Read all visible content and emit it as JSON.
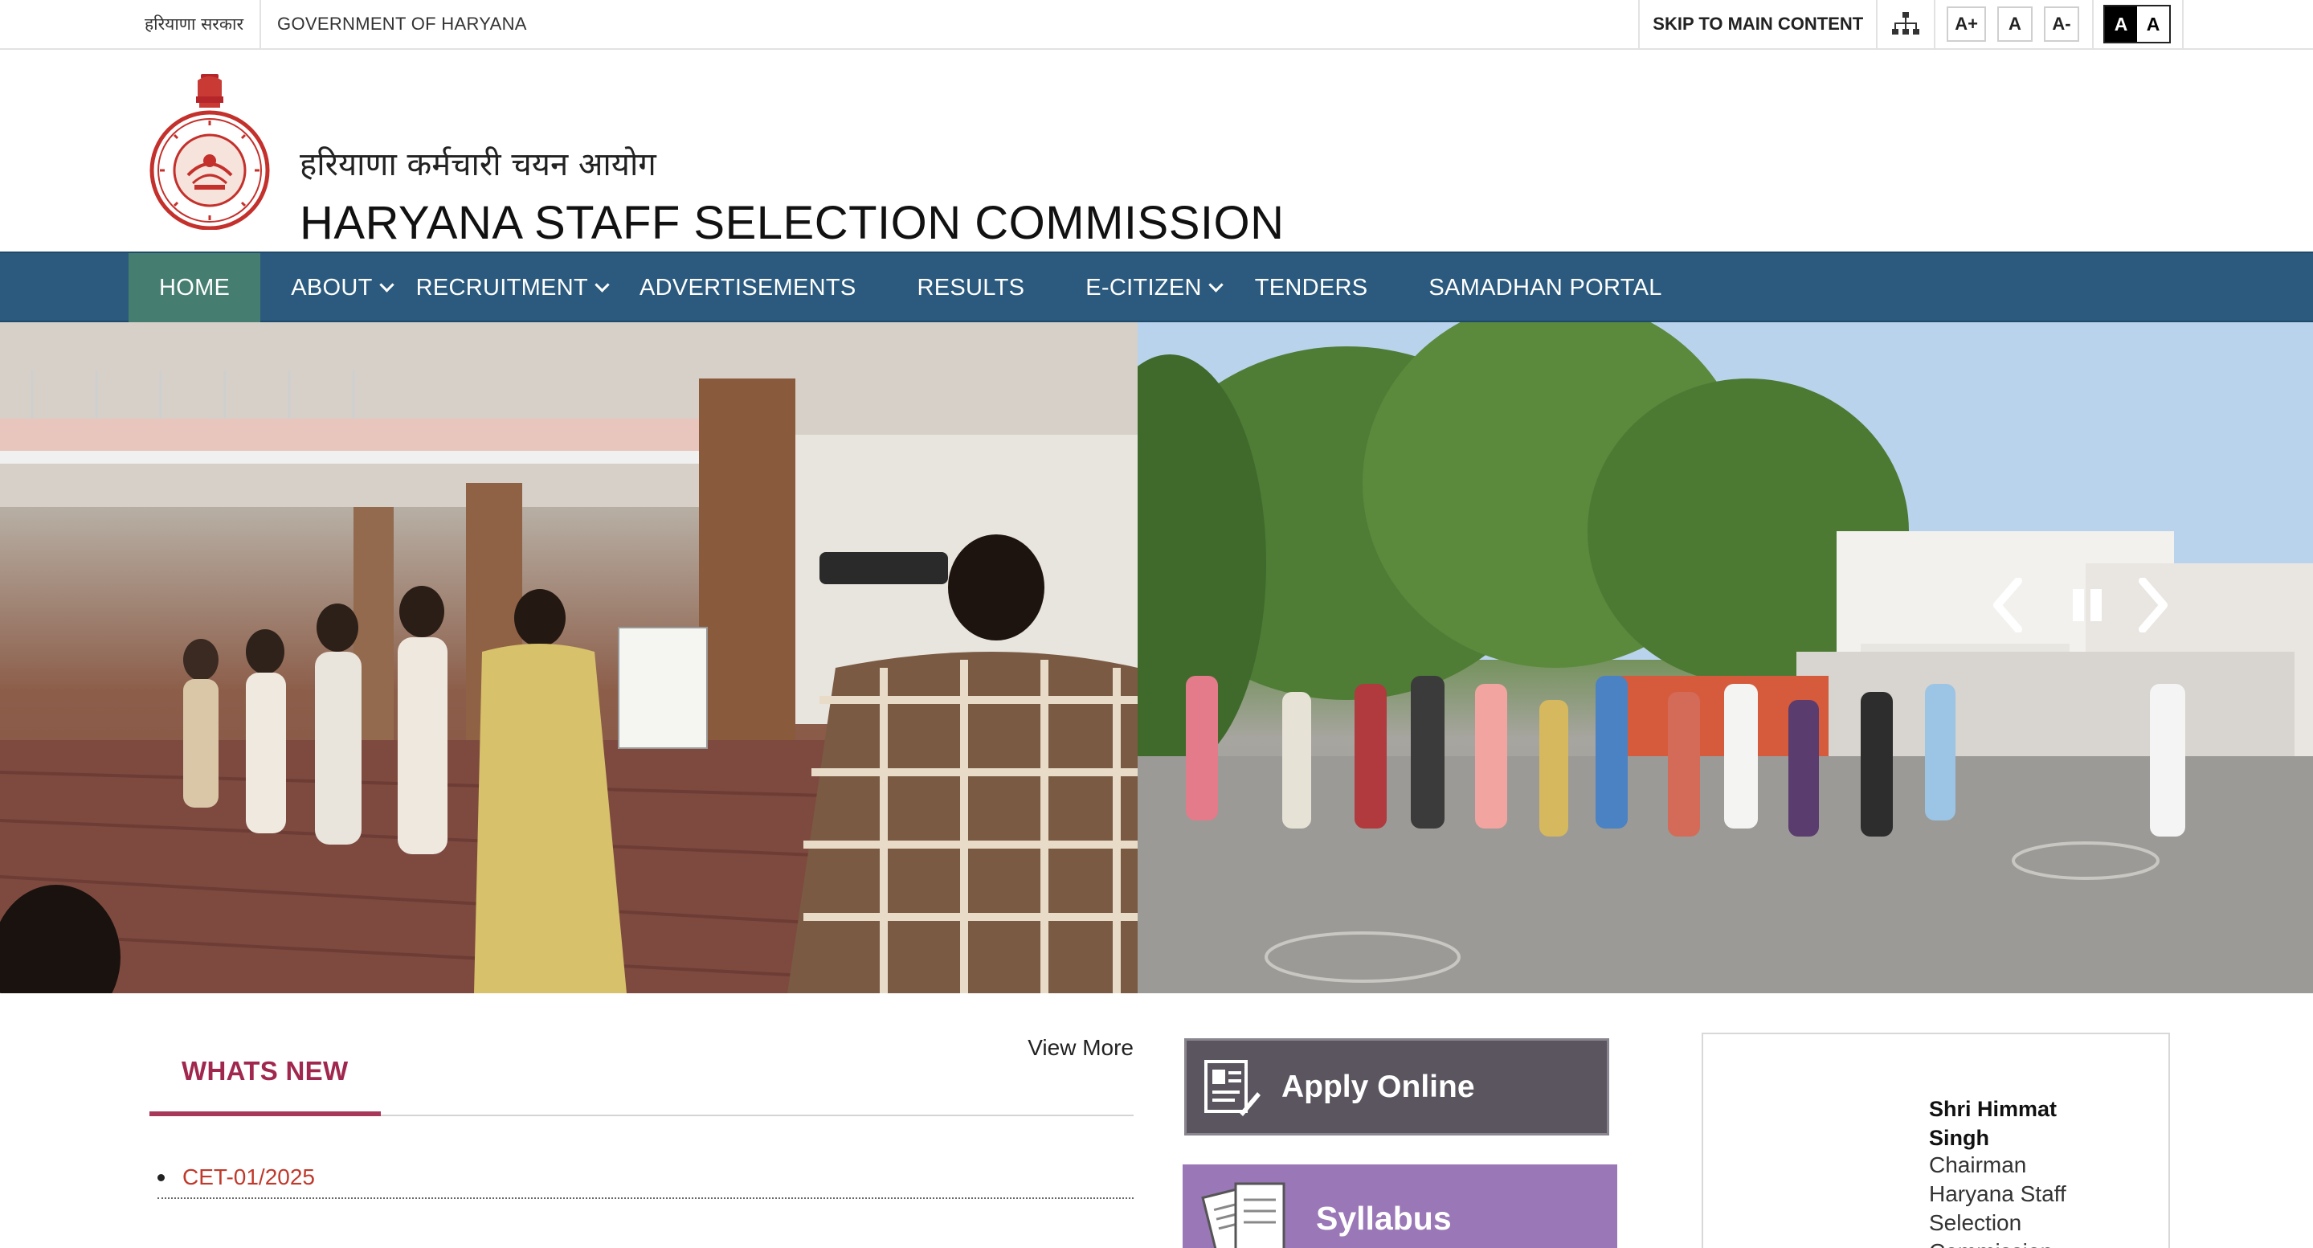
{
  "topbar": {
    "gov_hindi": "हरियाणा सरकार",
    "gov_english": "GOVERNMENT OF HARYANA",
    "skip_label": "SKIP TO MAIN CONTENT",
    "font_increase": "A+",
    "font_normal": "A",
    "font_decrease": "A-",
    "contrast_dark": "A",
    "contrast_light": "A"
  },
  "header": {
    "title_hindi": "हरियाणा कर्मचारी चयन आयोग",
    "title_english": "HARYANA STAFF SELECTION COMMISSION",
    "emblem_icon": "haryana-emblem-icon"
  },
  "nav": {
    "items": [
      {
        "label": "HOME",
        "active": true
      },
      {
        "label": "ABOUT",
        "dropdown": true
      },
      {
        "label": "RECRUITMENT",
        "dropdown": true
      },
      {
        "label": "ADVERTISEMENTS"
      },
      {
        "label": "RESULTS"
      },
      {
        "label": "E-CITIZEN",
        "dropdown": true
      },
      {
        "label": "TENDERS"
      },
      {
        "label": "SAMADHAN PORTAL"
      }
    ]
  },
  "banner": {
    "controls": [
      "previous-icon",
      "pause-icon",
      "next-icon"
    ]
  },
  "whats_new": {
    "title": "WHATS NEW",
    "view_more": "View More",
    "items": [
      "CET-01/2025"
    ]
  },
  "tiles": {
    "apply_online": "Apply Online",
    "syllabus": "Syllabus"
  },
  "chairman": {
    "name": "Shri Himmat Singh",
    "role": "Chairman Haryana Staff Selection Commission"
  },
  "colors": {
    "nav_bg": "#2b5a7e",
    "nav_active": "#457e70",
    "accent_maroon": "#a0284f",
    "link_red": "#c0392b"
  }
}
